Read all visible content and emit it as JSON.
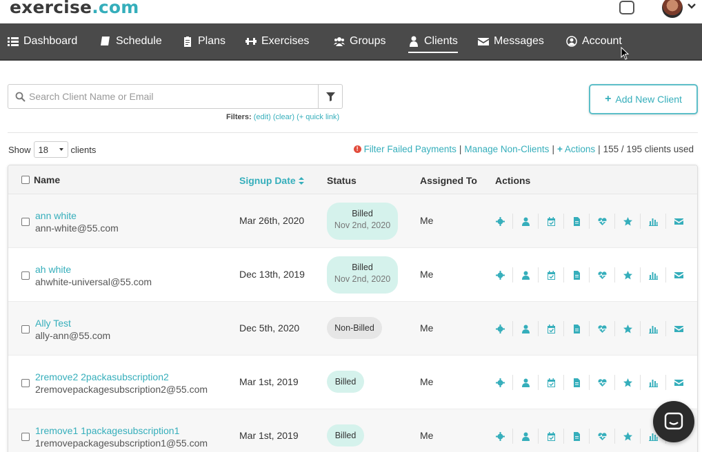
{
  "app": {
    "logo_part1": "exercise",
    "logo_part2": ".com",
    "brand_color": "#35aebb"
  },
  "nav": {
    "items": [
      {
        "label": "Dashboard",
        "icon": "list-icon"
      },
      {
        "label": "Schedule",
        "icon": "book-icon"
      },
      {
        "label": "Plans",
        "icon": "clipboard-icon"
      },
      {
        "label": "Exercises",
        "icon": "dumbbell-icon"
      },
      {
        "label": "Groups",
        "icon": "users-icon"
      },
      {
        "label": "Clients",
        "icon": "user-icon",
        "active": true
      },
      {
        "label": "Messages",
        "icon": "envelope-icon"
      },
      {
        "label": "Account",
        "icon": "user-circle-icon"
      }
    ]
  },
  "search": {
    "placeholder": "Search Client Name or Email",
    "filters_label": "Filters:",
    "edit": "(edit)",
    "clear": "(clear)",
    "quick_link": "(+ quick link)"
  },
  "add_client": {
    "label": "Add New Client"
  },
  "list_controls": {
    "show_label": "Show",
    "show_value": "18",
    "clients_label": "clients",
    "filter_failed": "Filter Failed Payments",
    "manage_non_clients": "Manage Non-Clients",
    "actions": "Actions",
    "usage": "155 / 195 clients used"
  },
  "table": {
    "headers": {
      "name": "Name",
      "signup": "Signup Date",
      "status": "Status",
      "assigned": "Assigned To",
      "actions": "Actions"
    },
    "action_icons": [
      "gear-icon",
      "user-icon",
      "calendar-icon",
      "document-icon",
      "heartbeat-icon",
      "star-icon",
      "bar-chart-icon",
      "envelope-icon"
    ],
    "rows": [
      {
        "name": "ann white",
        "email": "ann-white@55.com",
        "signup": "Mar 26th, 2020",
        "status": "Billed",
        "status_sub": "Nov 2nd, 2020",
        "assigned": "Me"
      },
      {
        "name": "ah white",
        "email": "ahwhite-universal@55.com",
        "signup": "Dec 13th, 2019",
        "status": "Billed",
        "status_sub": "Nov 2nd, 2020",
        "assigned": "Me"
      },
      {
        "name": "Ally Test",
        "email": "ally-ann@55.com",
        "signup": "Dec 5th, 2020",
        "status": "Non-Billed",
        "status_sub": "",
        "assigned": "Me"
      },
      {
        "name": "2remove2 2packasubscription2",
        "email": "2removepackagesubscription2@55.com",
        "signup": "Mar 1st, 2019",
        "status": "Billed",
        "status_sub": "",
        "assigned": "Me"
      },
      {
        "name": "1remove1 1packagesubscription1",
        "email": "1removepackagesubscription1@55.com",
        "signup": "Mar 1st, 2019",
        "status": "Billed",
        "status_sub": "",
        "assigned": "Me"
      }
    ]
  }
}
